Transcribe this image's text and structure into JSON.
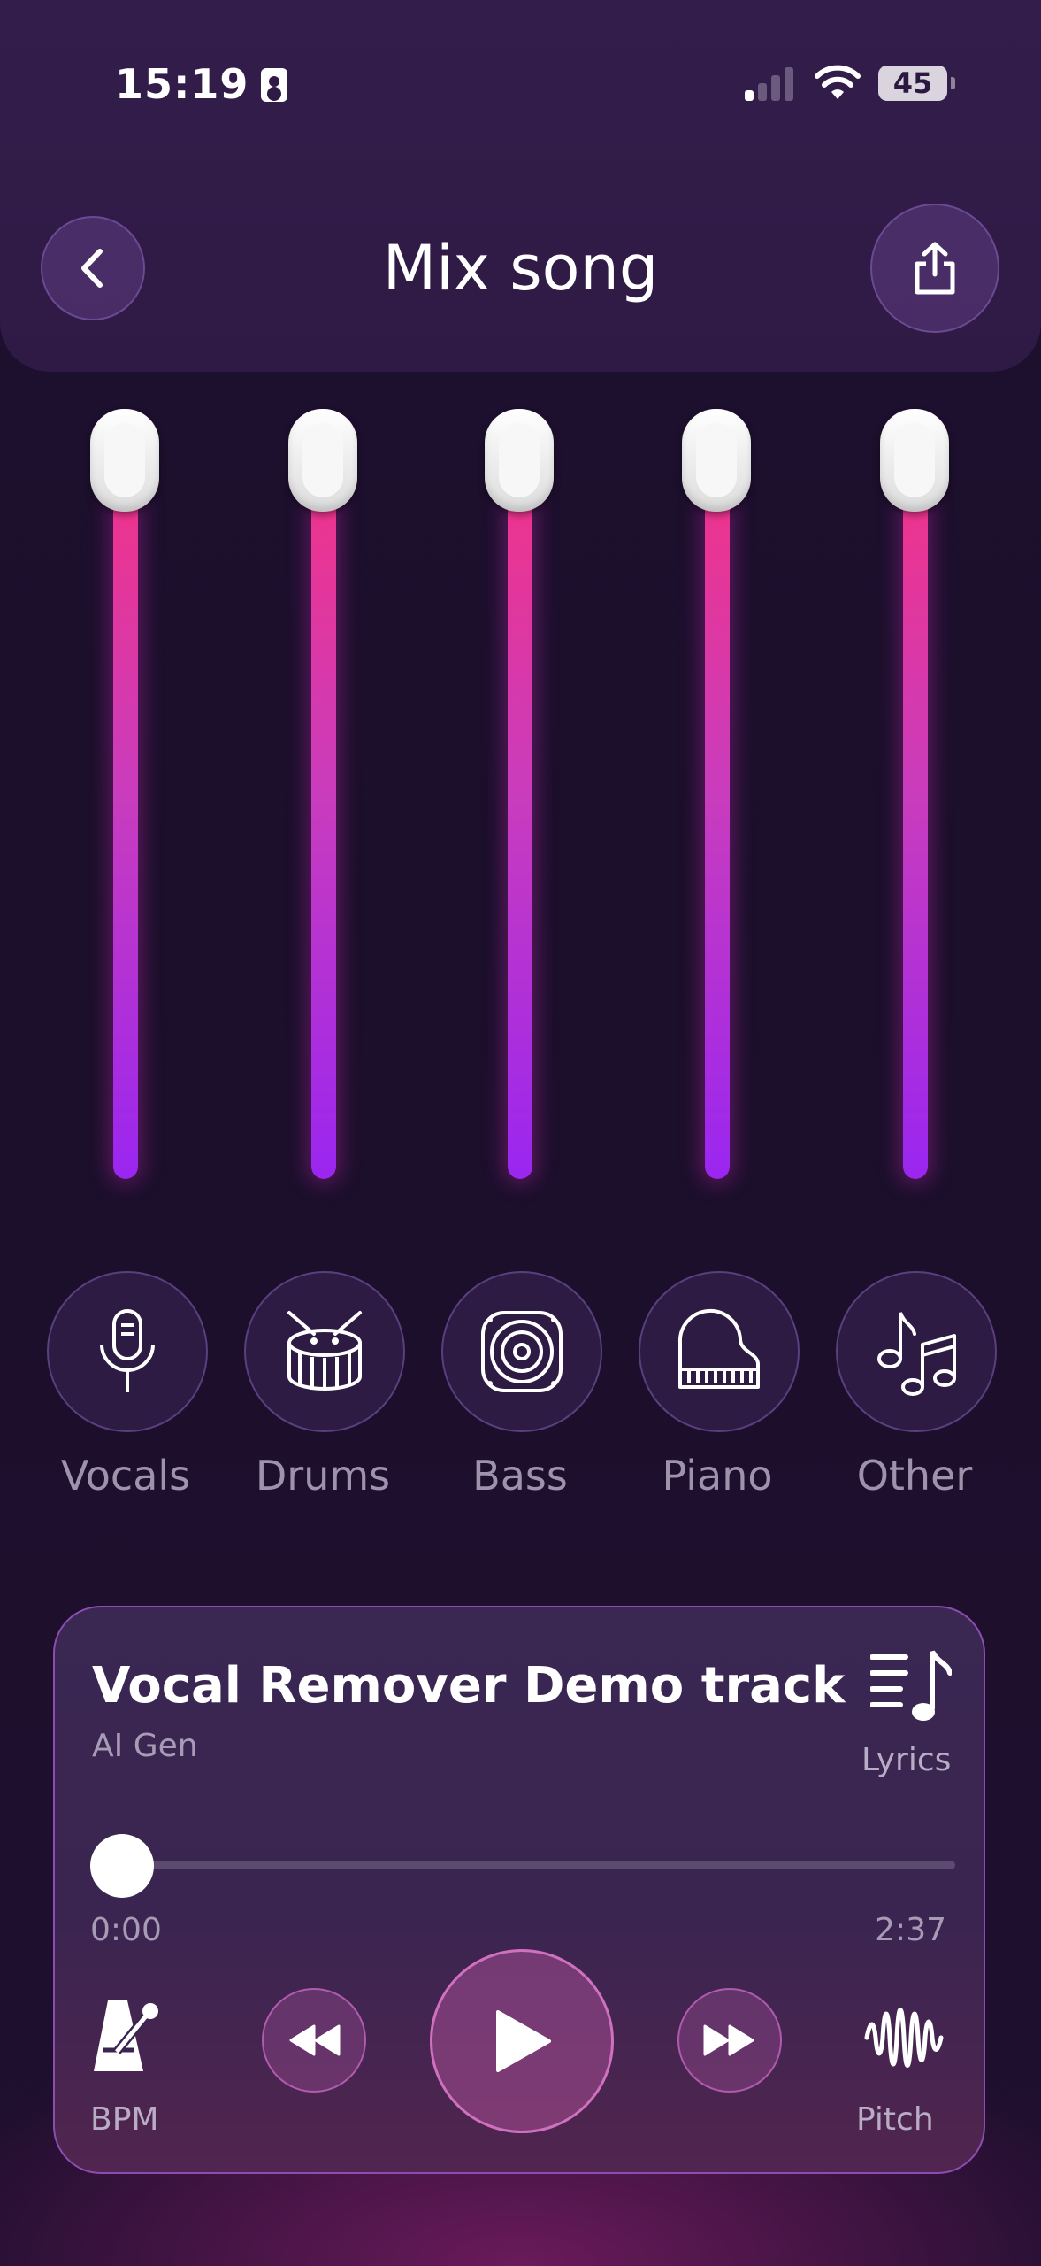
{
  "status": {
    "time": "15:19",
    "battery": "45"
  },
  "header": {
    "title": "Mix song"
  },
  "stems": [
    {
      "label": "Vocals",
      "icon": "microphone-icon",
      "level": 1.0
    },
    {
      "label": "Drums",
      "icon": "drum-icon",
      "level": 1.0
    },
    {
      "label": "Bass",
      "icon": "speaker-icon",
      "level": 1.0
    },
    {
      "label": "Piano",
      "icon": "piano-icon",
      "level": 1.0
    },
    {
      "label": "Other",
      "icon": "music-notes-icon",
      "level": 1.0
    }
  ],
  "player": {
    "title": "Vocal Remover Demo track",
    "artist": "AI Gen",
    "lyrics_label": "Lyrics",
    "current_time": "0:00",
    "total_time": "2:37",
    "progress": 0.0,
    "bpm_label": "BPM",
    "pitch_label": "Pitch"
  },
  "colors": {
    "accent_top": "#f0338a",
    "accent_bottom": "#9a26f0",
    "background": "#1b0f2b"
  }
}
